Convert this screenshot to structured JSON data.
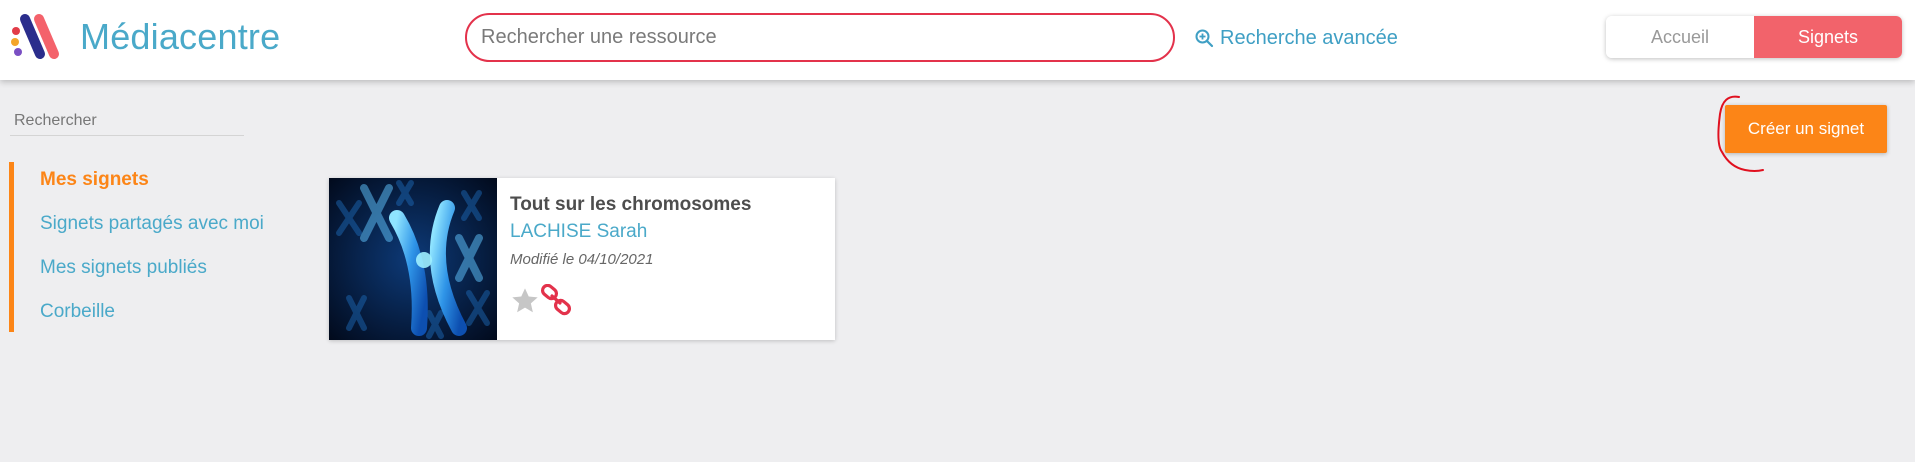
{
  "header": {
    "app_title": "Médiacentre",
    "search": {
      "placeholder": "Rechercher une ressource",
      "value": ""
    },
    "advanced_search_label": "Recherche avancée",
    "nav": {
      "home_label": "Accueil",
      "bookmarks_label": "Signets",
      "active": "Signets"
    }
  },
  "sidebar": {
    "search_placeholder": "Rechercher",
    "items": [
      {
        "label": "Mes signets",
        "active": true
      },
      {
        "label": "Signets partagés avec moi",
        "active": false
      },
      {
        "label": "Mes signets publiés",
        "active": false
      },
      {
        "label": "Corbeille",
        "active": false
      }
    ]
  },
  "toolbar": {
    "create_label": "Créer un signet"
  },
  "bookmarks": [
    {
      "title": "Tout sur les chromosomes",
      "author": "LACHISE Sarah",
      "modified": "Modifié le 04/10/2021",
      "image": "chromosome-image",
      "favorite": false,
      "icons": [
        "star-icon",
        "link-icon"
      ]
    }
  ],
  "colors": {
    "brand_blue": "#4aa9c9",
    "accent_orange": "#fc8517",
    "accent_red": "#f2636b",
    "search_border": "#e3324b"
  }
}
